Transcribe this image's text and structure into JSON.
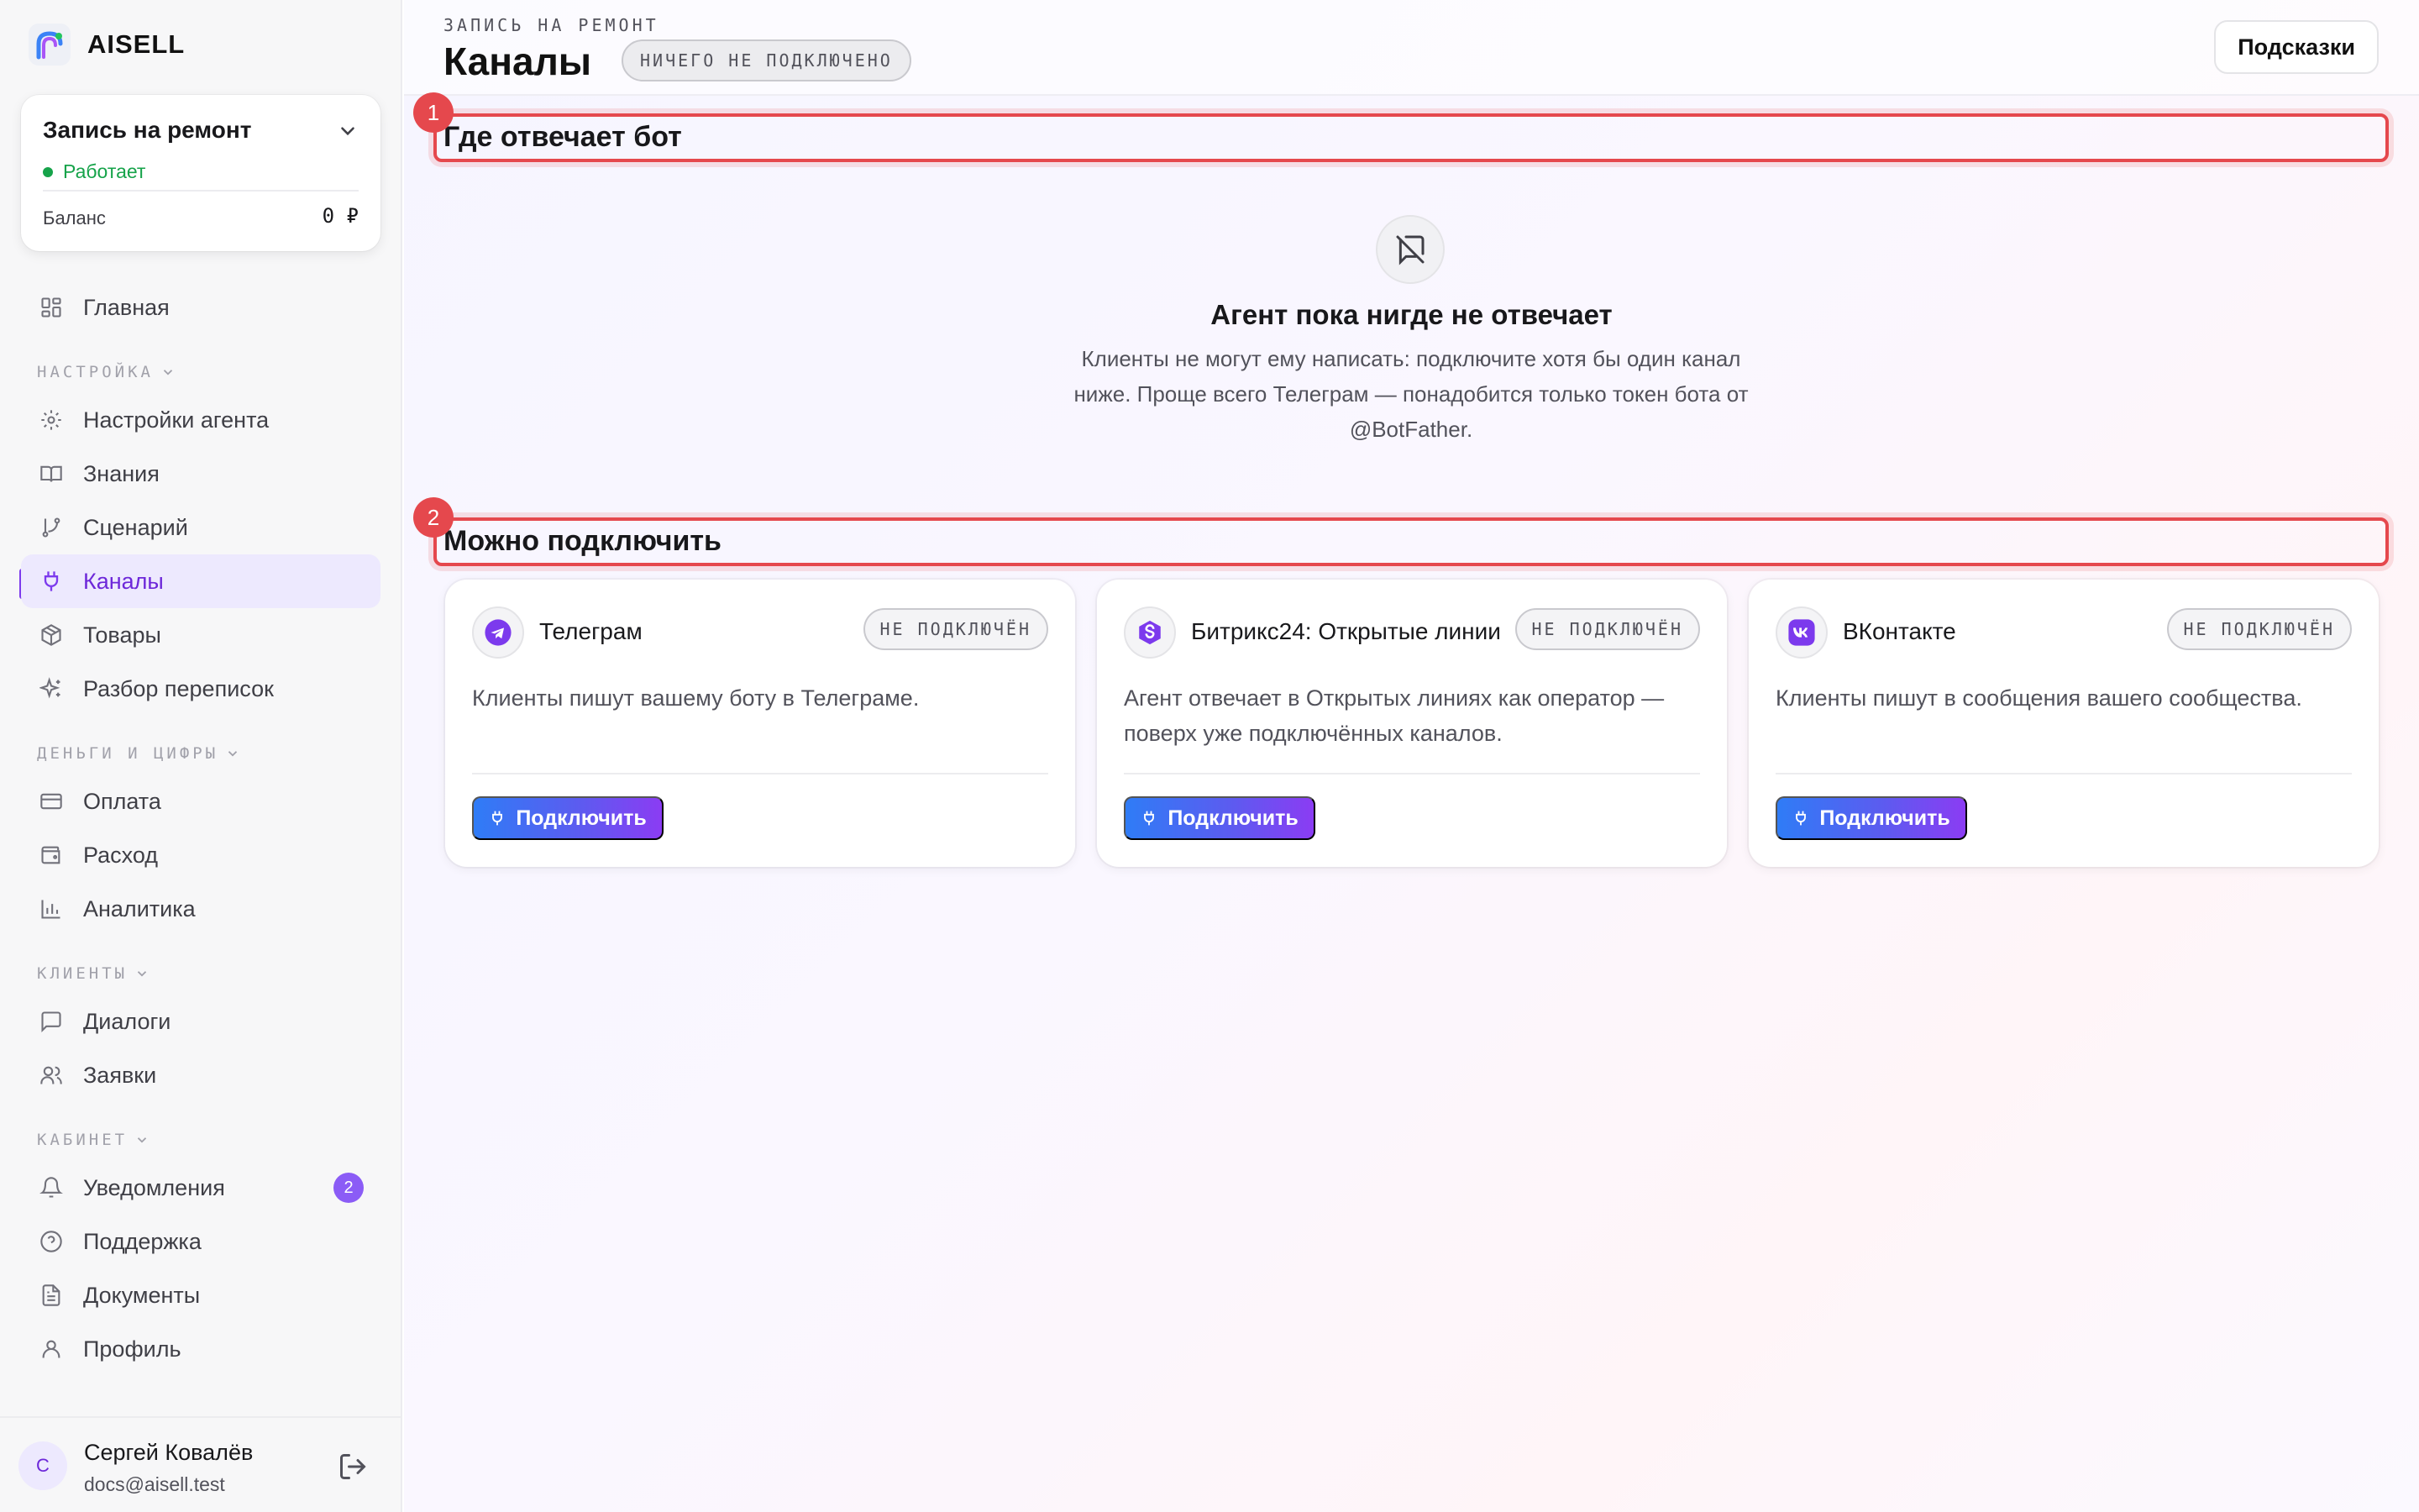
{
  "brand": {
    "name": "AISELL"
  },
  "project": {
    "name": "Запись на ремонт",
    "status": "Работает",
    "balance_label": "Баланс",
    "balance_value": "0 ₽"
  },
  "nav": {
    "home": "Главная",
    "section_setup": "НАСТРОЙКА",
    "agent_settings": "Настройки агента",
    "knowledge": "Знания",
    "scenario": "Сценарий",
    "channels": "Каналы",
    "products": "Товары",
    "chat_review": "Разбор переписок",
    "section_money": "ДЕНЬГИ И ЦИФРЫ",
    "payment": "Оплата",
    "expense": "Расход",
    "analytics": "Аналитика",
    "section_clients": "КЛИЕНТЫ",
    "dialogs": "Диалоги",
    "requests": "Заявки",
    "section_account": "КАБИНЕТ",
    "notifications": "Уведомления",
    "notifications_count": "2",
    "support": "Поддержка",
    "documents": "Документы",
    "profile": "Профиль"
  },
  "user": {
    "initial": "С",
    "name": "Сергей Ковалёв",
    "email": "docs@aisell.test"
  },
  "header": {
    "breadcrumb": "ЗАПИСЬ НА РЕМОНТ",
    "title": "Каналы",
    "pill": "НИЧЕГО НЕ ПОДКЛЮЧЕНО",
    "hints": "Подсказки"
  },
  "section1": {
    "marker": "1",
    "title": "Где отвечает бот"
  },
  "empty": {
    "title": "Агент пока нигде не отвечает",
    "text": "Клиенты не могут ему написать: подключите хотя бы один канал ниже. Проще всего Телеграм — понадобится только токен бота от @BotFather."
  },
  "section2": {
    "marker": "2",
    "title": "Можно подключить"
  },
  "channels": [
    {
      "title": "Телеграм",
      "badge": "НЕ ПОДКЛЮЧЁН",
      "desc": "Клиенты пишут вашему боту в Телеграме.",
      "button": "Подключить",
      "icon": "telegram-icon",
      "color": "#7c3aed"
    },
    {
      "title": "Битрикс24: Открытые линии",
      "badge": "НЕ ПОДКЛЮЧЁН",
      "desc": "Агент отвечает в Открытых линиях как оператор — поверх уже подключённых каналов.",
      "button": "Подключить",
      "icon": "bitrix24-icon",
      "color": "#7c3aed"
    },
    {
      "title": "ВКонтакте",
      "badge": "НЕ ПОДКЛЮЧЁН",
      "desc": "Клиенты пишут в сообщения вашего сообщества.",
      "button": "Подключить",
      "icon": "vk-icon",
      "color": "#7c3aed"
    }
  ],
  "colors": {
    "accent": "#7c3aed",
    "marker": "#e5484d",
    "status": "#16a34a"
  }
}
